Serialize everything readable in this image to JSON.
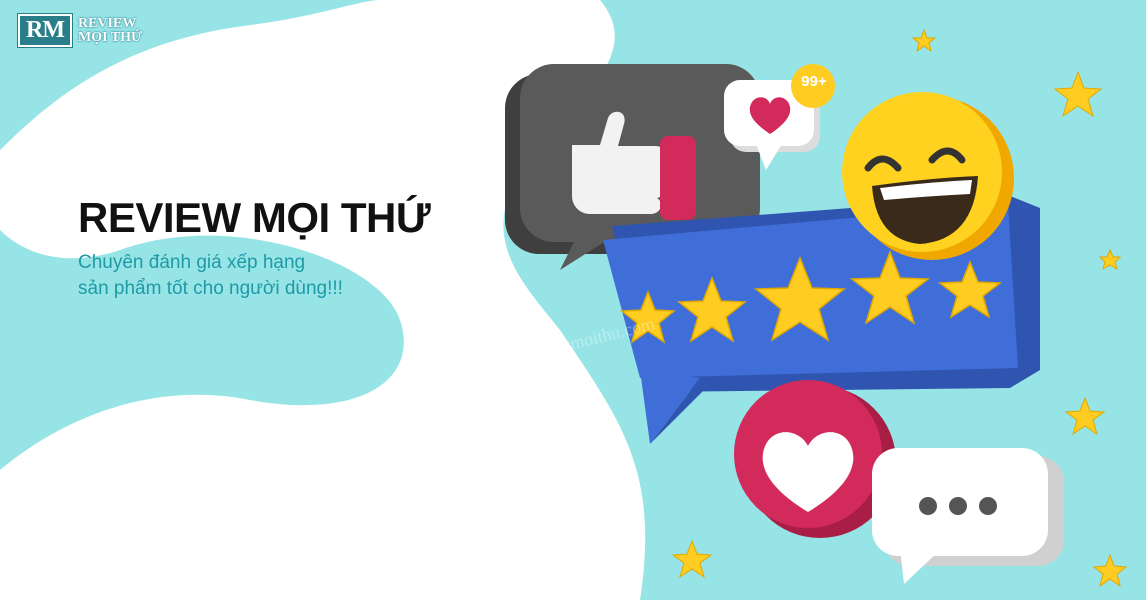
{
  "brand": {
    "logo_initials": "RM",
    "logo_line1": "REVIEW",
    "logo_line2": "MỌI THỨ"
  },
  "hero": {
    "headline": "REVIEW MỌI THỨ",
    "tagline_line1": "Chuyên đánh giá xếp hạng",
    "tagline_line2": "sản phẩm tốt cho người dùng!!!"
  },
  "badge": {
    "count": "99+"
  },
  "watermark": "Reviewmoithu.com",
  "colors": {
    "background": "#96e4e6",
    "blob": "#ffffff",
    "rating_panel": "#3f6ed8",
    "star": "#ffcc22",
    "heart_red": "#d32a5c",
    "tagline": "#1f9aa6"
  },
  "rating": {
    "stars": 5,
    "max": 5
  }
}
